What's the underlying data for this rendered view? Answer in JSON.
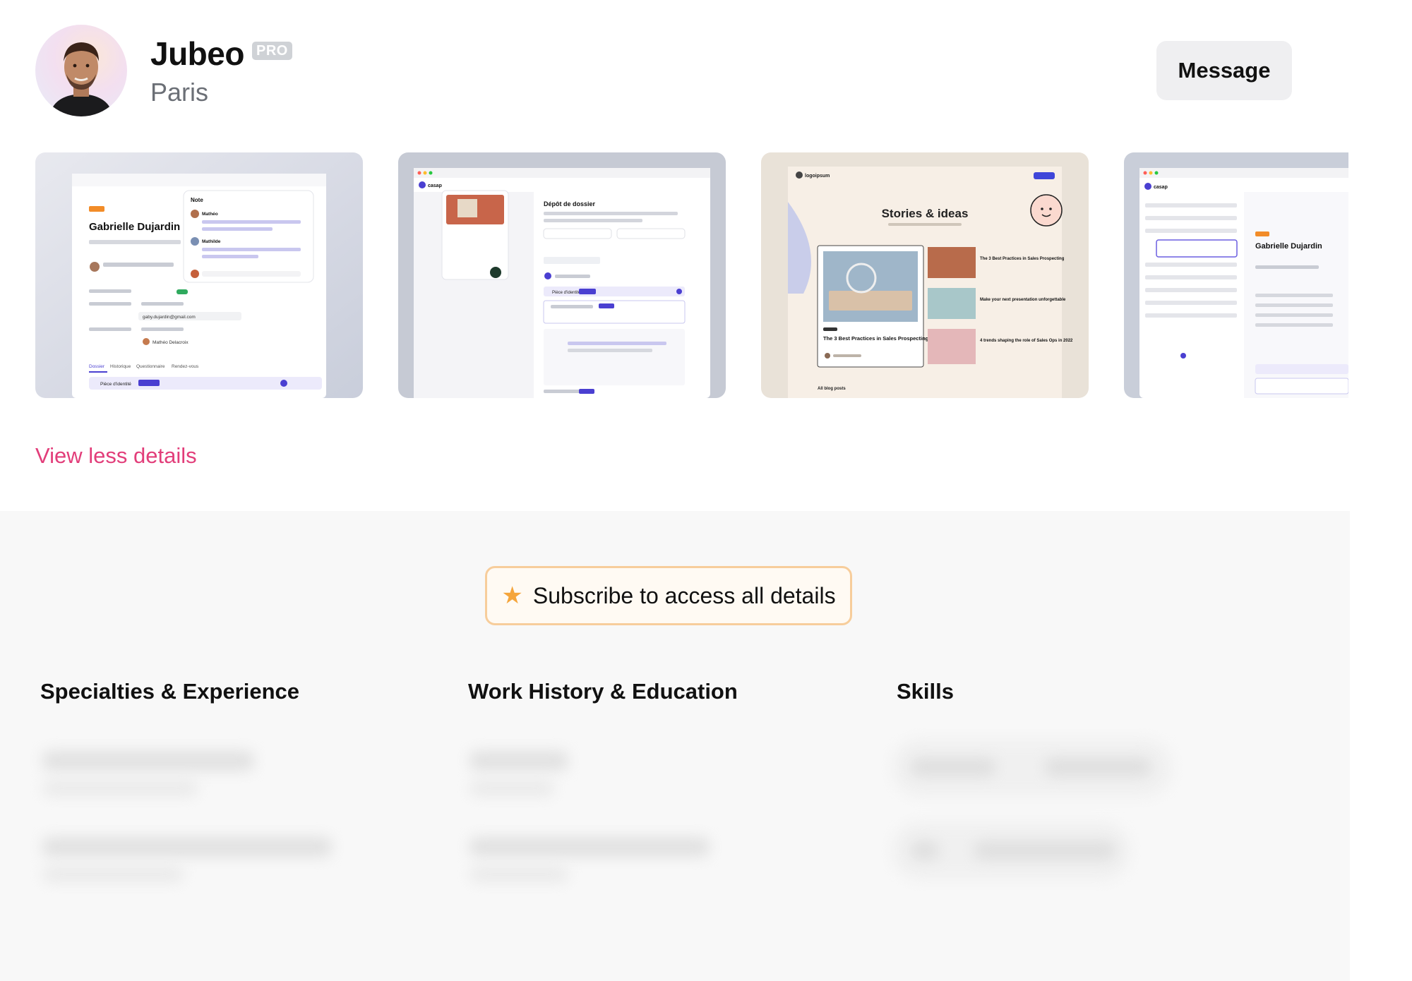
{
  "profile": {
    "name": "Jubeo",
    "badge": "PRO",
    "location": "Paris"
  },
  "actions": {
    "message_label": "Message",
    "view_less_label": "View less details",
    "subscribe_label": "Subscribe to access all details"
  },
  "gallery": {
    "items": [
      {
        "name": "Gabrielle Dujardin",
        "note_title": "Note",
        "note_author_1": "Mathéo",
        "note_author_2": "Mathilde",
        "email": "gaby.dujardin@gmail.com",
        "agent": "Mathéo Delacroix",
        "tabs": [
          "Dossier",
          "Historique",
          "Questionnaire",
          "Rendez-vous"
        ],
        "row_label": "Pièce d'identité"
      },
      {
        "brand": "casap",
        "title": "Dépôt de dossier",
        "row_label": "Pièce d'identité"
      },
      {
        "brand": "logoipsum",
        "title": "Stories & ideas",
        "card_title": "The 3 Best Practices in Sales Prospecting",
        "side_1": "The 3 Best Practices in Sales Prospecting",
        "side_2": "Make your next presentation unforgettable",
        "side_3": "4 trends shaping the role of Sales Ops in 2022",
        "footer": "All blog posts"
      },
      {
        "brand": "casap",
        "name": "Gabrielle Dujardin"
      }
    ]
  },
  "sections": [
    {
      "title": "Specialties & Experience"
    },
    {
      "title": "Work History & Education"
    },
    {
      "title": "Skills"
    }
  ],
  "colors": {
    "accent_pink": "#e23e7a",
    "star": "#f5a53b",
    "subscribe_border": "#f7cd9b",
    "casap_purple": "#4a3fd1"
  }
}
